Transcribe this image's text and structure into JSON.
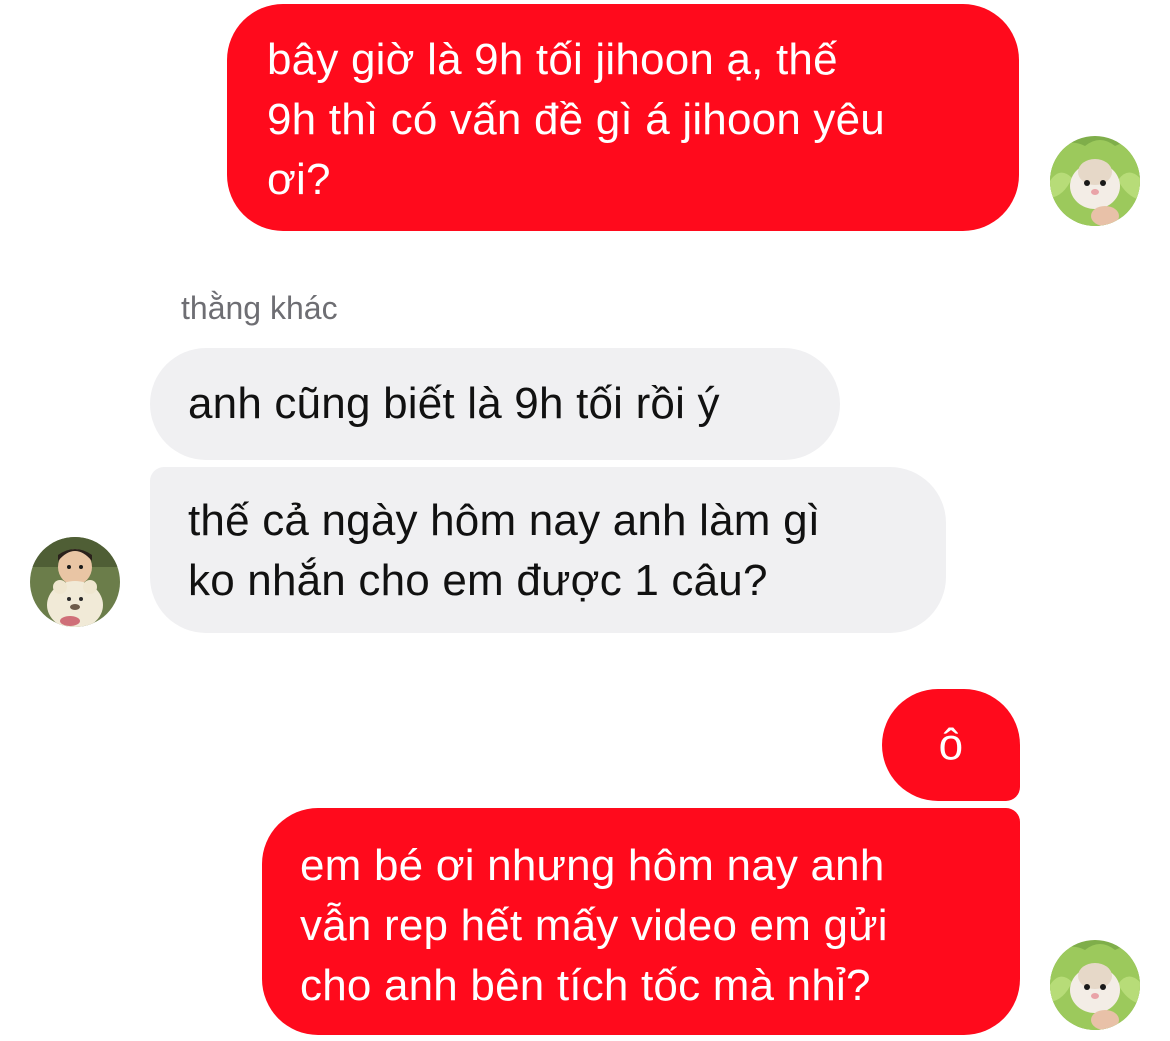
{
  "colors": {
    "outgoing_bubble": "#ff0a1c",
    "incoming_bubble": "#f0f0f2",
    "sender_name": "#6e6e73"
  },
  "avatars": {
    "self": "hamster-lettuce-avatar",
    "other": "child-with-teddy-bear-avatar"
  },
  "conversation": {
    "sender_name": "thằng khác",
    "messages": [
      {
        "side": "outgoing",
        "lines": [
          "bây giờ là 9h tối jihoon ạ, thế",
          "9h thì có vấn đề gì á jihoon yêu",
          "ơi?"
        ]
      },
      {
        "side": "incoming",
        "lines": [
          "anh cũng biết là 9h tối rồi ý"
        ]
      },
      {
        "side": "incoming",
        "lines": [
          "thế cả ngày hôm nay anh làm gì",
          "ko nhắn cho em được 1 câu?"
        ]
      },
      {
        "side": "outgoing",
        "lines": [
          "ô"
        ]
      },
      {
        "side": "outgoing",
        "lines": [
          "em bé ơi nhưng hôm nay anh",
          "vẫn rep hết mấy video em gửi",
          "cho anh bên tích tốc mà nhỉ?"
        ]
      }
    ]
  }
}
